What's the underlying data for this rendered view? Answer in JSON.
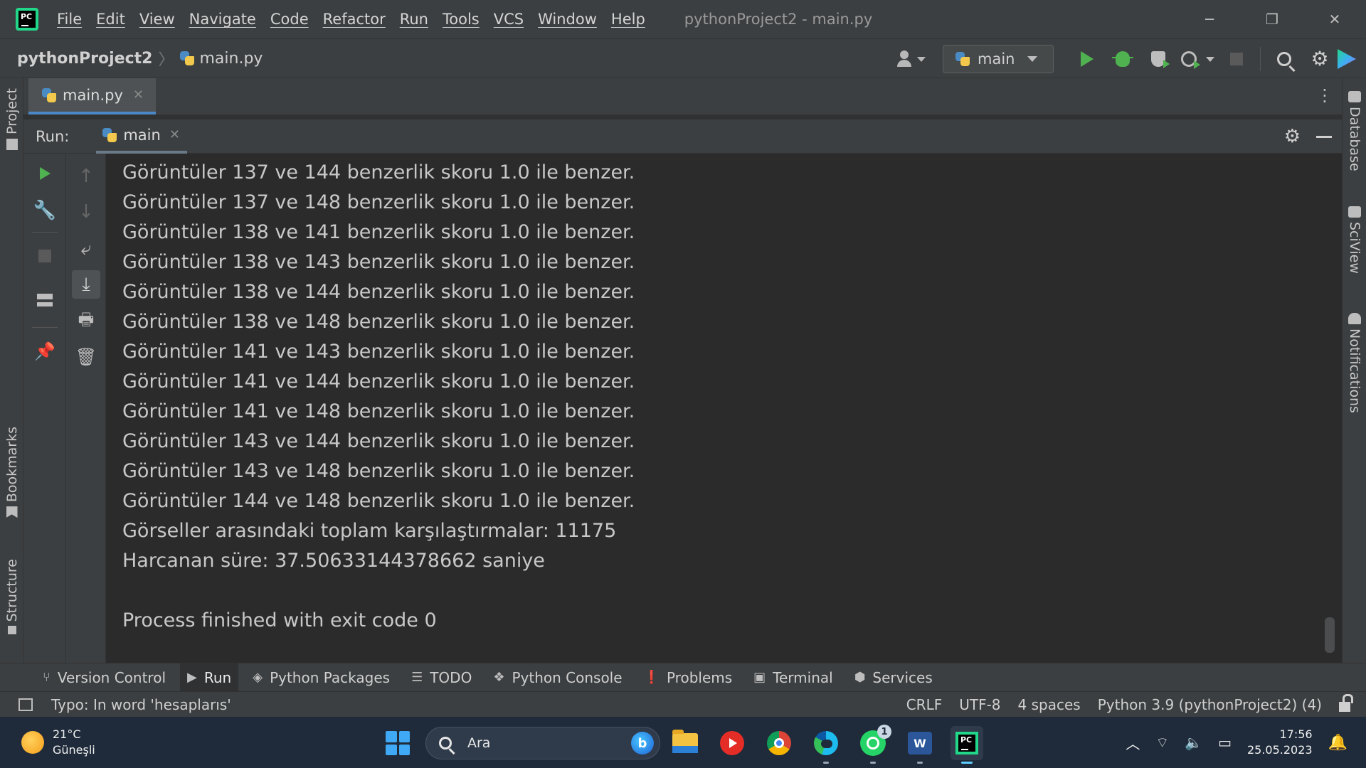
{
  "menu": {
    "items": [
      "File",
      "Edit",
      "View",
      "Navigate",
      "Code",
      "Refactor",
      "Run",
      "Tools",
      "VCS",
      "Window",
      "Help"
    ],
    "window_title": "pythonProject2 - main.py",
    "logo_text": "PC"
  },
  "window_controls": {
    "minimize": "─",
    "restore": "❐",
    "close": "✕"
  },
  "navbar": {
    "project": "pythonProject2",
    "file": "main.py",
    "run_config": "main"
  },
  "left_tabs": {
    "project": "Project",
    "bookmarks": "Bookmarks",
    "structure": "Structure"
  },
  "right_tabs": {
    "database": "Database",
    "sciview": "SciView",
    "notifications": "Notifications"
  },
  "editor_tabs": [
    {
      "label": "main.py"
    }
  ],
  "run_window": {
    "label": "Run:",
    "tab": "main"
  },
  "console": {
    "lines": [
      "Görüntüler 137 ve 144 benzerlik skoru 1.0 ile benzer.",
      "Görüntüler 137 ve 148 benzerlik skoru 1.0 ile benzer.",
      "Görüntüler 138 ve 141 benzerlik skoru 1.0 ile benzer.",
      "Görüntüler 138 ve 143 benzerlik skoru 1.0 ile benzer.",
      "Görüntüler 138 ve 144 benzerlik skoru 1.0 ile benzer.",
      "Görüntüler 138 ve 148 benzerlik skoru 1.0 ile benzer.",
      "Görüntüler 141 ve 143 benzerlik skoru 1.0 ile benzer.",
      "Görüntüler 141 ve 144 benzerlik skoru 1.0 ile benzer.",
      "Görüntüler 141 ve 148 benzerlik skoru 1.0 ile benzer.",
      "Görüntüler 143 ve 144 benzerlik skoru 1.0 ile benzer.",
      "Görüntüler 143 ve 148 benzerlik skoru 1.0 ile benzer.",
      "Görüntüler 144 ve 148 benzerlik skoru 1.0 ile benzer.",
      "Görseller arasındaki toplam karşılaştırmalar: 11175",
      "Harcanan süre: 37.50633144378662 saniye",
      "",
      "Process finished with exit code 0"
    ]
  },
  "bottom_tools": [
    {
      "label": "Version Control",
      "icon": "branch-icon"
    },
    {
      "label": "Run",
      "icon": "play-icon"
    },
    {
      "label": "Python Packages",
      "icon": "layers-icon"
    },
    {
      "label": "TODO",
      "icon": "list-icon"
    },
    {
      "label": "Python Console",
      "icon": "python-icon"
    },
    {
      "label": "Problems",
      "icon": "alert-icon"
    },
    {
      "label": "Terminal",
      "icon": "terminal-icon"
    },
    {
      "label": "Services",
      "icon": "services-icon"
    }
  ],
  "status": {
    "message": "Typo: In word 'hesaplarıs'",
    "line_sep": "CRLF",
    "encoding": "UTF-8",
    "indent": "4 spaces",
    "interpreter": "Python 3.9 (pythonProject2) (4)"
  },
  "taskbar": {
    "temperature": "21°C",
    "weather": "Güneşli",
    "search_placeholder": "Ara",
    "bing_letter": "b",
    "whatsapp_badge": "1",
    "word_letter": "W",
    "pycharm_letter": "PC",
    "time": "17:56",
    "date": "25.05.2023"
  },
  "colors": {
    "accent": "#4a88c7",
    "run_green": "#4fb14f",
    "console_bg": "#2b2b2b",
    "panel_bg": "#3c3f41"
  }
}
